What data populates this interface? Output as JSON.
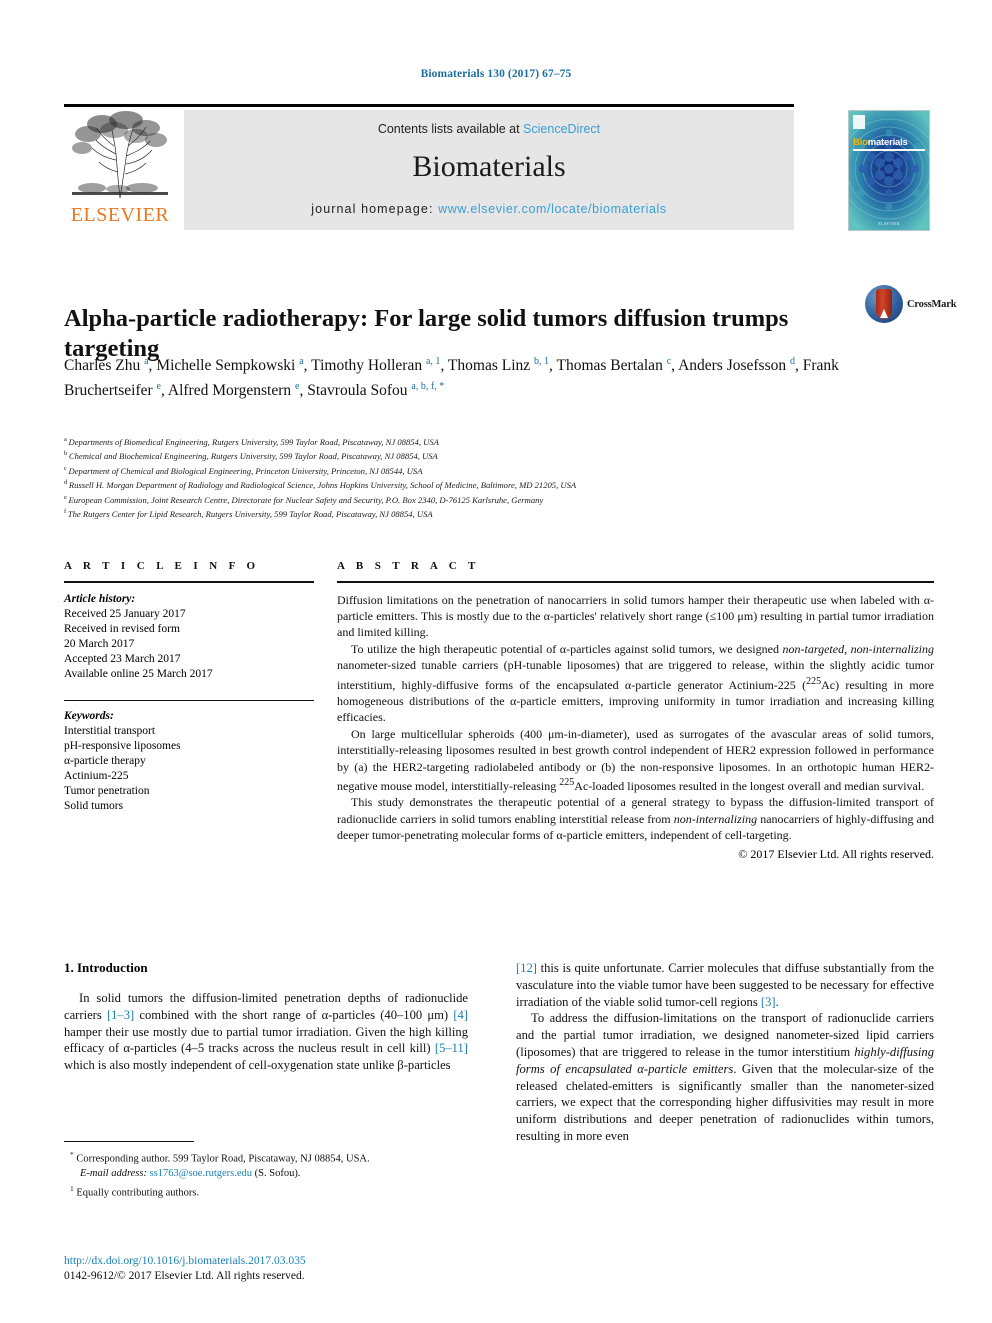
{
  "running_head": "Biomaterials 130 (2017) 67–75",
  "masthead": {
    "contents_prefix": "Contents lists available at ",
    "sciencedirect": "ScienceDirect",
    "journal_name": "Biomaterials",
    "homepage_prefix": "journal homepage: ",
    "homepage_url": "www.elsevier.com/locate/biomaterials",
    "publisher_wordmark": "ELSEVIER",
    "publisher_color": "#E87722",
    "link_color": "#3a9fd6",
    "panel_color": "#e6e6e6"
  },
  "cover": {
    "title_bi": "Bio",
    "title_materials": "materials",
    "footer": "ELSEVIER",
    "accent_color": "#f2b705",
    "background_color": "#2f8f9d"
  },
  "crossmark": {
    "label": "CrossMark"
  },
  "article": {
    "title": "Alpha-particle radiotherapy: For large solid tumors diffusion trumps targeting",
    "authors": [
      {
        "name": "Charles Zhu",
        "marks": "a",
        "sep": ", "
      },
      {
        "name": "Michelle Sempkowski",
        "marks": "a",
        "sep": ", "
      },
      {
        "name": "Timothy Holleran",
        "marks": "a, 1",
        "sep": ", "
      },
      {
        "name": "Thomas Linz",
        "marks": "b, 1",
        "sep": ", "
      },
      {
        "name": "Thomas Bertalan",
        "marks": "c",
        "sep": ", "
      },
      {
        "name": "Anders Josefsson",
        "marks": "d",
        "sep": ", "
      },
      {
        "name": "Frank Bruchertseifer",
        "marks": "e",
        "sep": ", "
      },
      {
        "name": "Alfred Morgenstern",
        "marks": "e",
        "sep": ", "
      },
      {
        "name": "Stavroula Sofou",
        "marks": "a, b, f, *",
        "sep": ""
      }
    ],
    "affiliations": [
      {
        "mark": "a",
        "text": "Departments of Biomedical Engineering, Rutgers University, 599 Taylor Road, Piscataway, NJ 08854, USA"
      },
      {
        "mark": "b",
        "text": "Chemical and Biochemical Engineering, Rutgers University, 599 Taylor Road, Piscataway, NJ 08854, USA"
      },
      {
        "mark": "c",
        "text": "Department of Chemical and Biological Engineering, Princeton University, Princeton, NJ 08544, USA"
      },
      {
        "mark": "d",
        "text": "Russell H. Morgan Department of Radiology and Radiological Science, Johns Hopkins University, School of Medicine, Baltimore, MD 21205, USA"
      },
      {
        "mark": "e",
        "text": "European Commission, Joint Research Centre, Directorate for Nuclear Safety and Security, P.O. Box 2340, D-76125 Karlsruhe, Germany"
      },
      {
        "mark": "f",
        "text": "The Rutgers Center for Lipid Research, Rutgers University, 599 Taylor Road, Piscataway, NJ 08854, USA"
      }
    ]
  },
  "article_info": {
    "heading": "A R T I C L E   I N F O",
    "history_label": "Article history:",
    "history": [
      "Received 25 January 2017",
      "Received in revised form",
      "20 March 2017",
      "Accepted 23 March 2017",
      "Available online 25 March 2017"
    ],
    "keywords_label": "Keywords:",
    "keywords": [
      "Interstitial transport",
      "pH-responsive liposomes",
      "α-particle therapy",
      "Actinium-225",
      "Tumor penetration",
      "Solid tumors"
    ]
  },
  "abstract": {
    "heading": "A B S T R A C T",
    "paragraphs": [
      "Diffusion limitations on the penetration of nanocarriers in solid tumors hamper their therapeutic use when labeled with α-particle emitters. This is mostly due to the α-particles' relatively short range (≤100 μm) resulting in partial tumor irradiation and limited killing.",
      "To utilize the high therapeutic potential of α-particles against solid tumors, we designed non-targeted, non-internalizing nanometer-sized tunable carriers (pH-tunable liposomes) that are triggered to release, within the slightly acidic tumor interstitium, highly-diffusive forms of the encapsulated α-particle generator Actinium-225 (225Ac) resulting in more homogeneous distributions of the α-particle emitters, improving uniformity in tumor irradiation and increasing killing efficacies.",
      "On large multicellular spheroids (400 μm-in-diameter), used as surrogates of the avascular areas of solid tumors, interstitially-releasing liposomes resulted in best growth control independent of HER2 expression followed in performance by (a) the HER2-targeting radiolabeled antibody or (b) the non-responsive liposomes. In an orthotopic human HER2-negative mouse model, interstitially-releasing 225Ac-loaded liposomes resulted in the longest overall and median survival.",
      "This study demonstrates the therapeutic potential of a general strategy to bypass the diffusion-limited transport of radionuclide carriers in solid tumors enabling interstitial release from non-internalizing nanocarriers of highly-diffusing and deeper tumor-penetrating molecular forms of α-particle emitters, independent of cell-targeting."
    ],
    "copyright": "© 2017 Elsevier Ltd. All rights reserved."
  },
  "introduction": {
    "heading": "1. Introduction",
    "left_paragraph": "In solid tumors the diffusion-limited penetration depths of radionuclide carriers [1–3] combined with the short range of α-particles (40–100 μm) [4] hamper their use mostly due to partial tumor irradiation. Given the high killing efficacy of α-particles (4–5 tracks across the nucleus result in cell kill) [5–11] which is also mostly independent of cell-oxygenation state unlike β-particles",
    "right_paragraph_1": "[12] this is quite unfortunate. Carrier molecules that diffuse substantially from the vasculature into the viable tumor have been suggested to be necessary for effective irradiation of the viable solid tumor-cell regions [3].",
    "right_paragraph_2": "To address the diffusion-limitations on the transport of radionuclide carriers and the partial tumor irradiation, we designed nanometer-sized lipid carriers (liposomes) that are triggered to release in the tumor interstitium highly-diffusing forms of encapsulated α-particle emitters. Given that the molecular-size of the released chelated-emitters is significantly smaller than the nanometer-sized carriers, we expect that the corresponding higher diffusivities may result in more uniform distributions and deeper penetration of radionuclides within tumors, resulting in more even",
    "reference_color": "#1a7fb5"
  },
  "footnotes": {
    "corresponding": "Corresponding author. 599 Taylor Road, Piscataway, NJ 08854, USA.",
    "email_label": "E-mail address:",
    "email": "ss1763@soe.rutgers.edu",
    "email_owner": "(S. Sofou).",
    "equal_contrib": "Equally contributing authors.",
    "star": "*",
    "one": "1"
  },
  "footer": {
    "doi": "http://dx.doi.org/10.1016/j.biomaterials.2017.03.035",
    "issn_copyright": "0142-9612/© 2017 Elsevier Ltd. All rights reserved."
  }
}
